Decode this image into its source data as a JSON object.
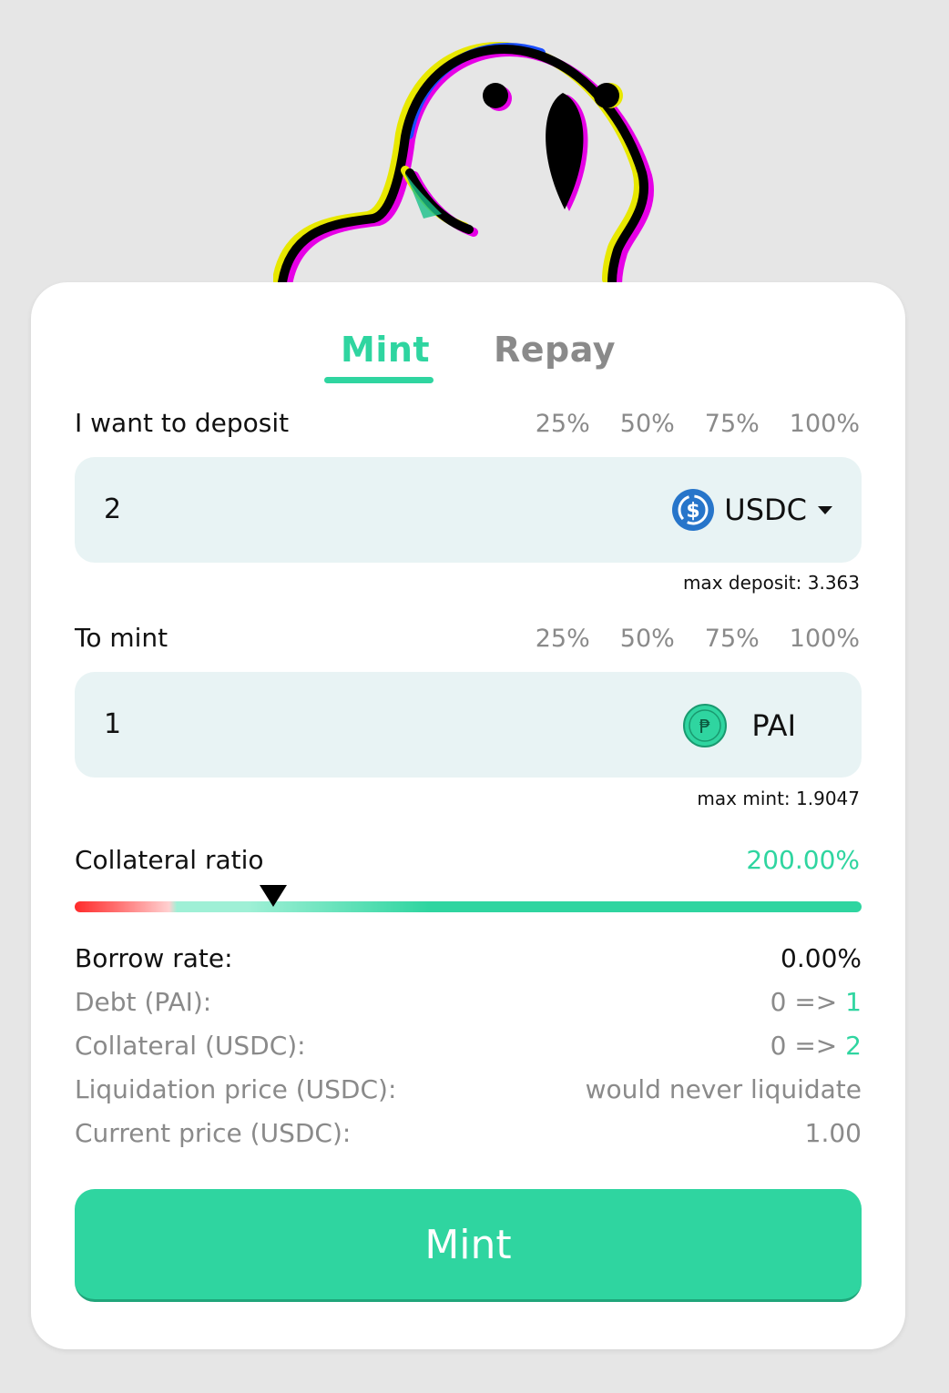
{
  "tabs": {
    "mint": "Mint",
    "repay": "Repay"
  },
  "deposit": {
    "label": "I want to deposit",
    "percentages": [
      "25%",
      "50%",
      "75%",
      "100%"
    ],
    "value": "2",
    "token": "USDC",
    "max_text": "max deposit: 3.363"
  },
  "mint_field": {
    "label": "To mint",
    "percentages": [
      "25%",
      "50%",
      "75%",
      "100%"
    ],
    "value": "1",
    "token": "PAI",
    "token_glyph": "₱",
    "max_text": "max mint: 1.9047"
  },
  "collateral": {
    "label": "Collateral ratio",
    "value": "200.00%"
  },
  "info": {
    "borrow_rate_label": "Borrow rate:",
    "borrow_rate_value": "0.00%",
    "debt_label": "Debt (PAI):",
    "debt_from": "0 =>",
    "debt_to": "1",
    "collateral_label": "Collateral (USDC):",
    "collateral_from": "0 =>",
    "collateral_to": "2",
    "liq_label": "Liquidation price (USDC):",
    "liq_value": "would never liquidate",
    "price_label": "Current price (USDC):",
    "price_value": "1.00"
  },
  "button": {
    "label": "Mint"
  },
  "colors": {
    "accent": "#2fd5a0",
    "field_bg": "#e8f3f4",
    "muted": "#8a8a8a",
    "usdc": "#2775ca"
  }
}
